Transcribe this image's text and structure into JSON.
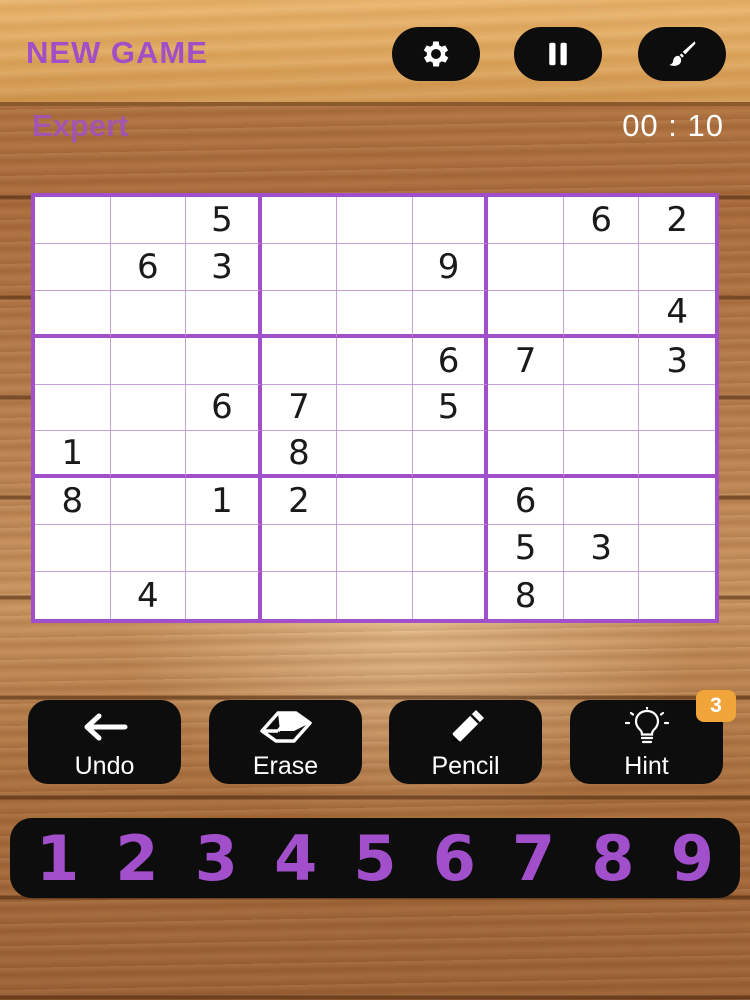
{
  "header": {
    "new_game_label": "NEW GAME",
    "buttons": [
      {
        "name": "settings-button",
        "icon": "gear-icon"
      },
      {
        "name": "pause-button",
        "icon": "pause-icon"
      },
      {
        "name": "theme-button",
        "icon": "paintbrush-icon"
      }
    ]
  },
  "status": {
    "difficulty": "Expert",
    "timer": "00 : 10"
  },
  "board": {
    "rows": [
      [
        "",
        "",
        "5",
        "",
        "",
        "",
        "",
        "6",
        "2"
      ],
      [
        "",
        "6",
        "3",
        "",
        "",
        "9",
        "",
        "",
        ""
      ],
      [
        "",
        "",
        "",
        "",
        "",
        "",
        "",
        "",
        "4"
      ],
      [
        "",
        "",
        "",
        "",
        "",
        "6",
        "7",
        "",
        "3"
      ],
      [
        "",
        "",
        "6",
        "7",
        "",
        "5",
        "",
        "",
        ""
      ],
      [
        "1",
        "",
        "",
        "8",
        "",
        "",
        "",
        "",
        ""
      ],
      [
        "8",
        "",
        "1",
        "2",
        "",
        "",
        "6",
        "",
        ""
      ],
      [
        "",
        "",
        "",
        "",
        "",
        "",
        "5",
        "3",
        ""
      ],
      [
        "",
        "4",
        "",
        "",
        "",
        "",
        "8",
        "",
        ""
      ]
    ]
  },
  "tools": {
    "undo": {
      "label": "Undo",
      "icon": "arrow-left-icon"
    },
    "erase": {
      "label": "Erase",
      "icon": "eraser-icon"
    },
    "pencil": {
      "label": "Pencil",
      "icon": "pencil-icon"
    },
    "hint": {
      "label": "Hint",
      "icon": "lightbulb-icon",
      "badge": "3"
    }
  },
  "numpad": [
    "1",
    "2",
    "3",
    "4",
    "5",
    "6",
    "7",
    "8",
    "9"
  ],
  "colors": {
    "accent": "#a24fcb",
    "hint_badge": "#f0a43a",
    "button_bg": "#0d0d0d"
  }
}
